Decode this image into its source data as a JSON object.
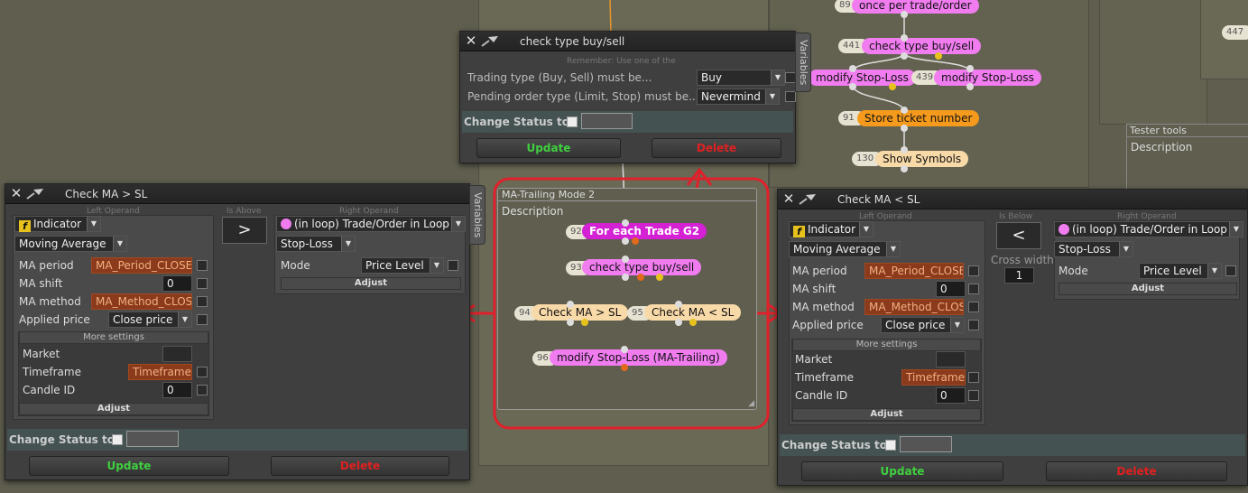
{
  "canvas_nodes": {
    "n89": {
      "id": "89",
      "label": "once per trade/order"
    },
    "n441": {
      "id": "441",
      "label": "check type buy/sell"
    },
    "n_left": {
      "label": "modify Stop-Loss"
    },
    "n439": {
      "id": "439",
      "label": "modify Stop-Loss"
    },
    "n91": {
      "id": "91",
      "label": "Store ticket number"
    },
    "n130": {
      "id": "130",
      "label": "Show Symbols"
    },
    "n447": {
      "id": "447"
    }
  },
  "tester_tools": {
    "title": "Tester tools",
    "desc": "Description"
  },
  "group": {
    "title": "MA-Trailing Mode 2",
    "desc": "Description",
    "nodes": {
      "n92": {
        "id": "92",
        "label": "For each Trade G2"
      },
      "n93": {
        "id": "93",
        "label": "check type buy/sell"
      },
      "n94": {
        "id": "94",
        "label": "Check MA > SL"
      },
      "n95": {
        "id": "95",
        "label": "Check MA < SL"
      },
      "n96": {
        "id": "96",
        "label": "modify Stop-Loss (MA-Trailing)"
      }
    }
  },
  "win_type": {
    "title": "check type buy/sell",
    "remember": "Remember: Use one of the",
    "row1_label": "Trading type (Buy, Sell) must be...",
    "row1_value": "Buy",
    "row2_label": "Pending order type (Limit, Stop) must be...",
    "row2_value": "Nevermind",
    "status_label": "Change Status to",
    "update": "Update",
    "delete": "Delete",
    "vtab": "Variables"
  },
  "win_left": {
    "title": "Check MA > SL",
    "left_operand": "Left Operand",
    "is_above": "Is Above",
    "right_operand": "Right Operand",
    "op": ">",
    "type": "Indicator",
    "indicator": "Moving Average",
    "ma_period_label": "MA period",
    "ma_period": "MA_Period_CLOSE",
    "ma_shift_label": "MA shift",
    "ma_shift": "0",
    "ma_method_label": "MA method",
    "ma_method": "MA_Method_CLOSE",
    "applied_label": "Applied price",
    "applied": "Close price",
    "more": "More settings",
    "market_label": "Market",
    "timeframe_label": "Timeframe",
    "timeframe": "Timeframe",
    "candle_label": "Candle ID",
    "candle": "0",
    "adjust": "Adjust",
    "rtype": "(in loop) Trade/Order in Loop",
    "rsub": "Stop-Loss",
    "mode_label": "Mode",
    "mode": "Price Level",
    "radjust": "Adjust",
    "status_label": "Change Status to",
    "update": "Update",
    "delete": "Delete",
    "vtab": "Variables"
  },
  "win_right": {
    "title": "Check MA < SL",
    "left_operand": "Left Operand",
    "is_below": "Is Below",
    "right_operand": "Right Operand",
    "op": "<",
    "cross_label": "Cross width",
    "cross": "1",
    "type": "Indicator",
    "indicator": "Moving Average",
    "ma_period_label": "MA period",
    "ma_period": "MA_Period_CLOSE",
    "ma_shift_label": "MA shift",
    "ma_shift": "0",
    "ma_method_label": "MA method",
    "ma_method": "MA_Method_CLOSE",
    "applied_label": "Applied price",
    "applied": "Close price",
    "more": "More settings",
    "market_label": "Market",
    "timeframe_label": "Timeframe",
    "timeframe": "Timeframe",
    "candle_label": "Candle ID",
    "candle": "0",
    "adjust": "Adjust",
    "rtype": "(in loop) Trade/Order in Loop",
    "rsub": "Stop-Loss",
    "mode_label": "Mode",
    "mode": "Price Level",
    "radjust": "Adjust",
    "status_label": "Change Status to",
    "update": "Update",
    "delete": "Delete"
  }
}
